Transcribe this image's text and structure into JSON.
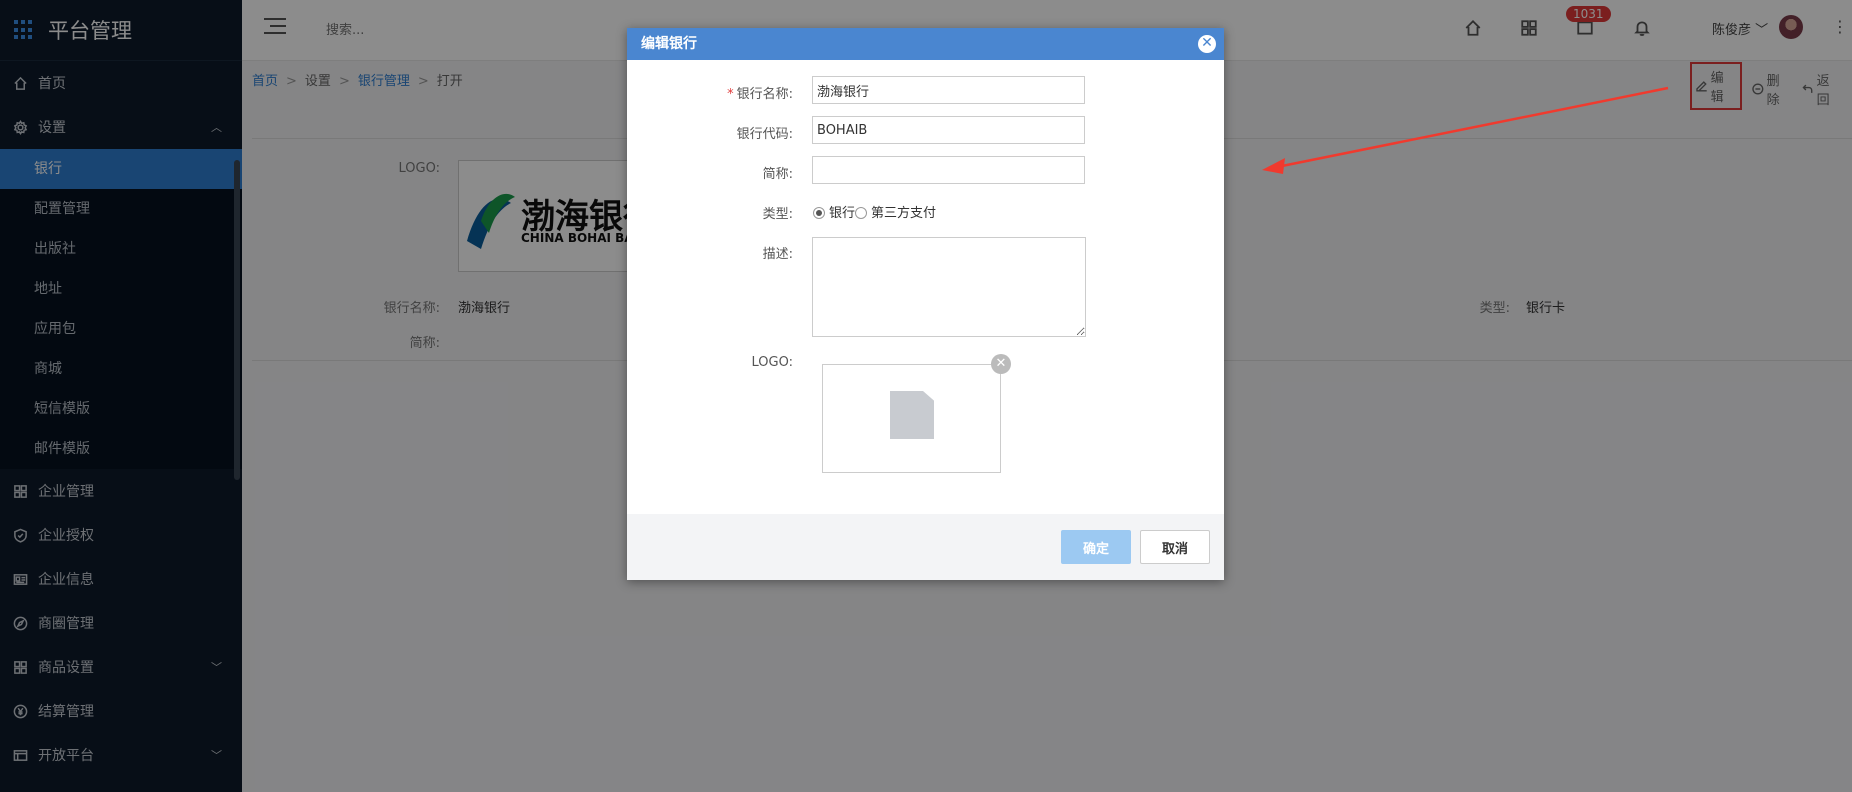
{
  "sidebar": {
    "brand": "平台管理",
    "items": [
      {
        "label": "首页",
        "icon": "home-icon"
      },
      {
        "label": "设置",
        "icon": "gear-icon",
        "expanded": true
      },
      {
        "label": "企业管理",
        "icon": "building-icon"
      },
      {
        "label": "企业授权",
        "icon": "shield-icon"
      },
      {
        "label": "企业信息",
        "icon": "id-card-icon"
      },
      {
        "label": "商圈管理",
        "icon": "compass-icon"
      },
      {
        "label": "商品设置",
        "icon": "grid-icon"
      },
      {
        "label": "结算管理",
        "icon": "yen-icon"
      },
      {
        "label": "开放平台",
        "icon": "list-icon"
      }
    ],
    "settings_sub": [
      "银行",
      "配置管理",
      "出版社",
      "地址",
      "应用包",
      "商城",
      "短信模版",
      "邮件模版"
    ]
  },
  "topbar": {
    "search_placeholder": "搜索...",
    "badge_count": "1031",
    "user_name": "陈俊彦"
  },
  "breadcrumb": {
    "home": "首页",
    "settings": "设置",
    "bank_mgmt": "银行管理",
    "current": "打开"
  },
  "actions": {
    "edit": "编辑",
    "delete": "删除",
    "back": "返回"
  },
  "detail": {
    "logo_label": "LOGO:",
    "bank_name_label": "银行名称:",
    "bank_name": "渤海银行",
    "short_label": "简称:",
    "type_label": "类型:",
    "type_value": "银行卡",
    "logo_text_cn": "渤海银行",
    "logo_text_en": "CHINA BOHAI BANK"
  },
  "modal": {
    "title": "编辑银行",
    "fields": {
      "bank_name_label": "银行名称:",
      "bank_name_value": "渤海银行",
      "bank_code_label": "银行代码:",
      "bank_code_value": "BOHAIB",
      "short_label": "简称:",
      "short_value": "",
      "type_label": "类型:",
      "type_option_bank": "银行",
      "type_option_third": "第三方支付",
      "desc_label": "描述:",
      "logo_label": "LOGO:"
    },
    "confirm": "确定",
    "cancel": "取消"
  },
  "colors": {
    "accent": "#2f7fd1",
    "header": "#4a86d0",
    "sidebar": "#0d1a2b",
    "badge": "#e03a3a"
  }
}
